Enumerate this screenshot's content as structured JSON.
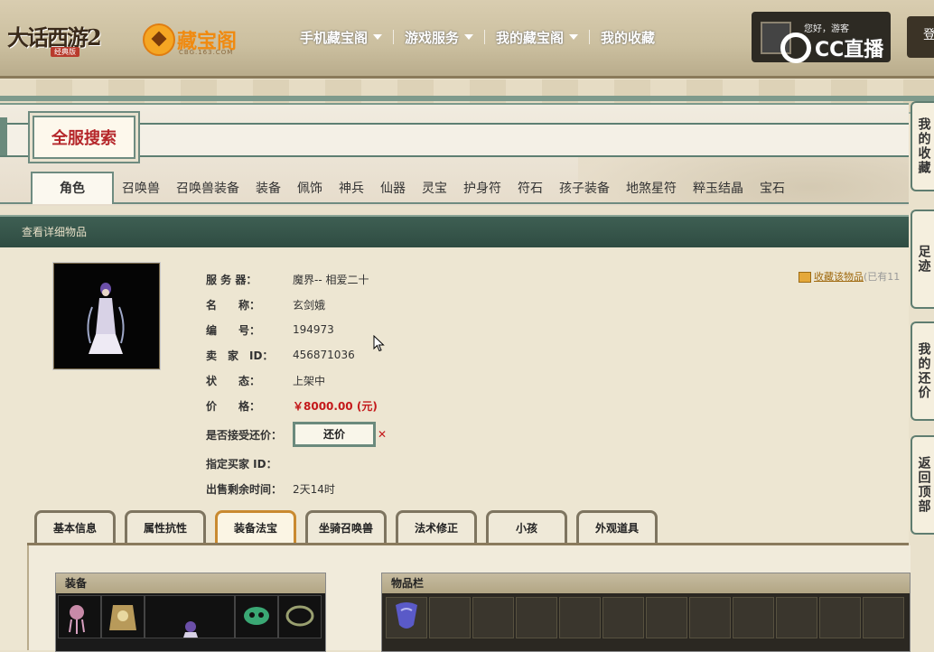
{
  "header": {
    "game_logo": "大话西游2",
    "game_logo_sub": "经典版",
    "site_logo": "藏宝阁",
    "site_logo_en": "CBG.163.COM",
    "nav": [
      {
        "label": "手机藏宝阁",
        "dropdown": true
      },
      {
        "label": "游戏服务",
        "dropdown": true
      },
      {
        "label": "我的藏宝阁",
        "dropdown": true
      },
      {
        "label": "我的收藏",
        "dropdown": false
      }
    ],
    "greeting": "您好，游客",
    "login_label": "登",
    "watermark": "CC直播"
  },
  "search": {
    "title": "全服搜索",
    "categories": [
      "角色",
      "召唤兽",
      "召唤兽装备",
      "装备",
      "佩饰",
      "神兵",
      "仙器",
      "灵宝",
      "护身符",
      "符石",
      "孩子装备",
      "地煞星符",
      "粹玉结晶",
      "宝石"
    ],
    "active_category": "角色"
  },
  "detail": {
    "header": "查看详细物品",
    "fields": [
      {
        "label": "服 务 器：",
        "value": "魔界-- 相爱二十"
      },
      {
        "label": "名　　称：",
        "value": "玄剑娥"
      },
      {
        "label": "编　　号：",
        "value": "194973"
      },
      {
        "label": "卖　家　ID：",
        "value": "456871036"
      },
      {
        "label": "状　　态：",
        "value": "上架中"
      },
      {
        "label": "价　　格：",
        "value": "￥8000.00 (元)"
      }
    ],
    "counter_label": "是否接受还价：",
    "counter_button": "还价",
    "buyer_label": "指定买家 ID：",
    "remaining_label": "出售剩余时间：",
    "remaining_value": "2天14时",
    "favorite": "收藏该物品",
    "favorite_count": "(已有11"
  },
  "tabs": [
    "基本信息",
    "属性抗性",
    "装备法宝",
    "坐骑召唤兽",
    "法术修正",
    "小孩",
    "外观道具"
  ],
  "active_tab": "装备法宝",
  "equip_panel": {
    "title": "装备"
  },
  "items_panel": {
    "title": "物品栏"
  },
  "sidebar": [
    {
      "label": "我的收藏"
    },
    {
      "label": "足迹"
    },
    {
      "label": "我的还价"
    },
    {
      "label": "返回顶部"
    }
  ],
  "colors": {
    "accent": "#c4191b",
    "frame": "#5f7d70",
    "header_bg": "#2f4c42"
  }
}
